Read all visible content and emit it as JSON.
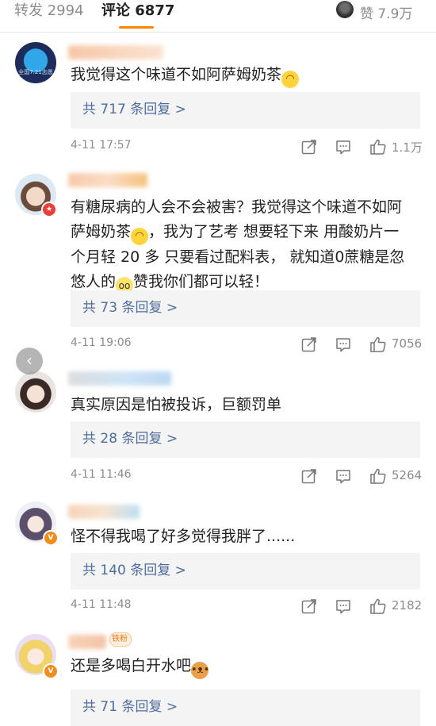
{
  "tabs": {
    "repost": "转发 2994",
    "comment": "评论 6877",
    "likes": "赞 7.9万"
  },
  "comments": [
    {
      "text": "我觉得这个味道不如阿萨姆奶茶",
      "avatar_text": "全国7.21志愿",
      "replies": "共 717 条回复 >",
      "time": "4-11 17:57",
      "likes": "1.1万"
    },
    {
      "text_parts": [
        "有糖尿病的人会不会被害？我觉得这个味道不如阿\n萨姆奶茶",
        "，我为了艺考 想要轻下来 用酸奶片一\n个月轻 20 多 只要看过配料表， 就知道0蔗糖是忽\n悠人的",
        "赞我你们都可以轻！"
      ],
      "replies": "共 73 条回复 >",
      "time": "4-11 19:06",
      "likes": "7056"
    },
    {
      "text": "真实原因是怕被投诉，巨额罚单",
      "replies": "共 28 条回复 >",
      "time": "4-11 11:46",
      "likes": "5264"
    },
    {
      "text": "怪不得我喝了好多觉得我胖了......",
      "replies": "共 140 条回复 >",
      "time": "4-11 11:48",
      "likes": "2182"
    },
    {
      "text": "还是多喝白开水吧",
      "fan_badge": "铁粉",
      "replies": "共 71 条回复 >"
    }
  ],
  "colors": {
    "accent": "#ff8200",
    "link": "#4f6d9d",
    "muted": "#8c8c8c"
  }
}
